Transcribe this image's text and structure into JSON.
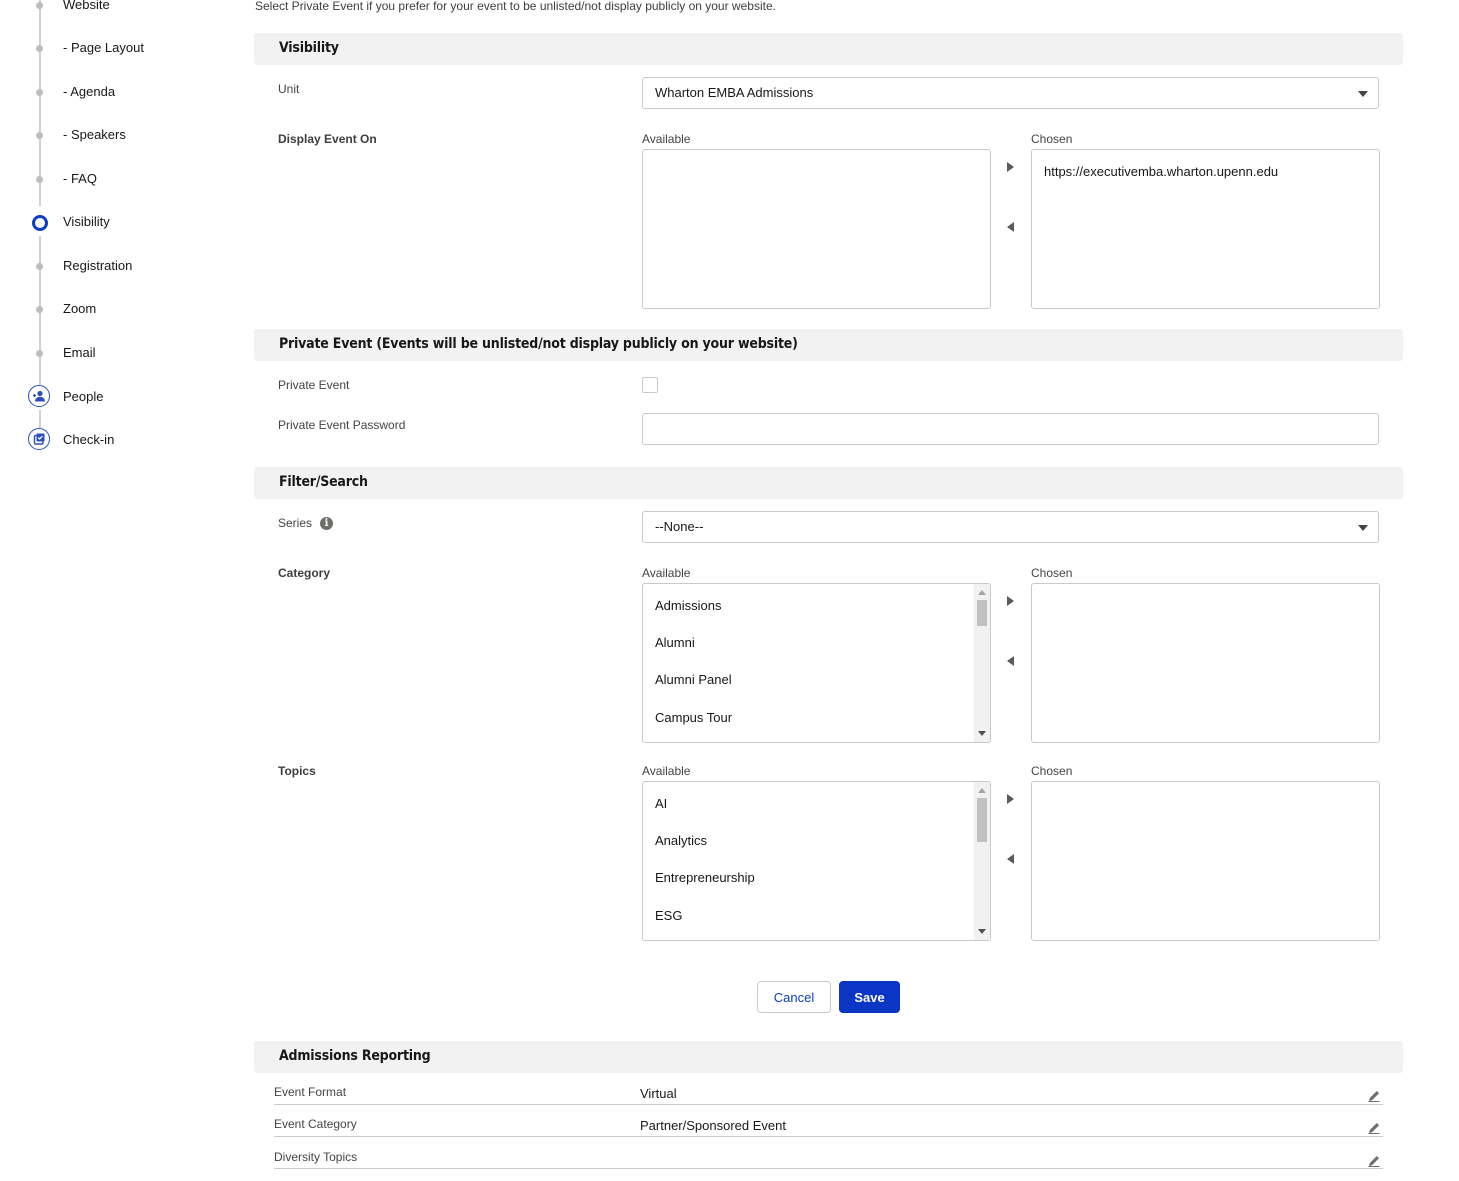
{
  "stepper": {
    "items": [
      {
        "label": "Website"
      },
      {
        "label": "- Page Layout"
      },
      {
        "label": "- Agenda"
      },
      {
        "label": "- Speakers"
      },
      {
        "label": "- FAQ"
      },
      {
        "label": "Visibility"
      },
      {
        "label": "Registration"
      },
      {
        "label": "Zoom"
      },
      {
        "label": "Email"
      },
      {
        "label": "People"
      },
      {
        "label": "Check-in"
      }
    ]
  },
  "intro_text": "Select Private Event if you prefer for your event to be unlisted/not display publicly on your website.",
  "visibility": {
    "header": "Visibility",
    "unit_label": "Unit",
    "unit_value": "Wharton EMBA Admissions",
    "display_label": "Display Event On",
    "available_label": "Available",
    "chosen_label": "Chosen",
    "display_available": [],
    "display_chosen": [
      "https://executivemba.wharton.upenn.edu"
    ]
  },
  "private_event": {
    "header": "Private Event (Events will be unlisted/not display publicly on your website)",
    "checkbox_label": "Private Event",
    "password_label": "Private Event Password",
    "password_value": ""
  },
  "filter": {
    "header": "Filter/Search",
    "series_label": "Series",
    "series_value": "--None--",
    "category_label": "Category",
    "category_available_label": "Available",
    "category_chosen_label": "Chosen",
    "category_available": [
      "Admissions",
      "Alumni",
      "Alumni Panel",
      "Campus Tour"
    ],
    "topics_label": "Topics",
    "topics_available_label": "Available",
    "topics_chosen_label": "Chosen",
    "topics_available": [
      "AI",
      "Analytics",
      "Entrepreneurship",
      "ESG"
    ]
  },
  "actions": {
    "cancel_label": "Cancel",
    "save_label": "Save"
  },
  "admissions_reporting": {
    "header": "Admissions Reporting",
    "rows": [
      {
        "label": "Event Format",
        "value": "Virtual"
      },
      {
        "label": "Event Category",
        "value": "Partner/Sponsored Event"
      },
      {
        "label": "Diversity Topics",
        "value": ""
      }
    ]
  },
  "colors": {
    "brand_blue": "#0b35c5",
    "section_bg": "#f3f2f2",
    "border": "#c9c9c9"
  }
}
